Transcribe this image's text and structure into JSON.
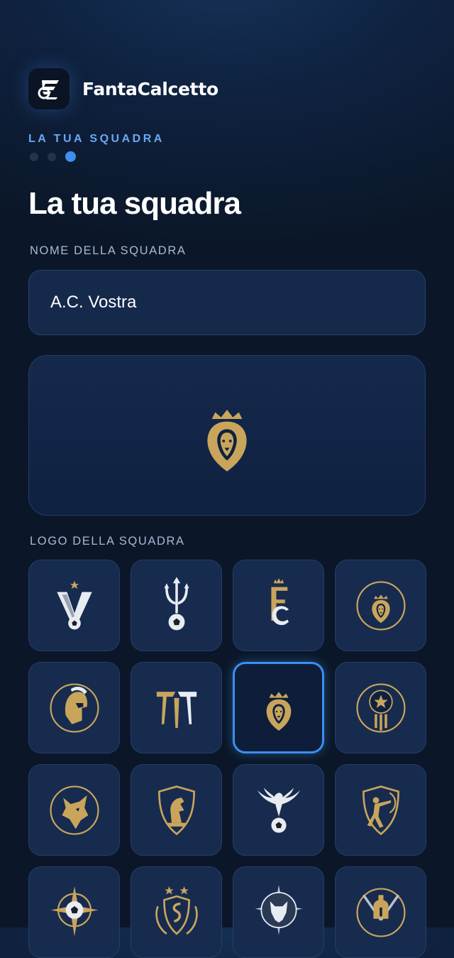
{
  "app": {
    "name": "FantaCalcetto",
    "icon": "fc-logo-icon"
  },
  "step": {
    "label": "LA TUA SQUADRA",
    "total": 3,
    "current": 3
  },
  "page": {
    "title": "La tua squadra"
  },
  "team_name": {
    "label": "NOME DELLA SQUADRA",
    "value": "A.C. Vostra"
  },
  "preview": {
    "logo": "crowned-lion-icon"
  },
  "logos": {
    "label": "LOGO DELLA SQUADRA",
    "selected_index": 6,
    "items": [
      {
        "name": "v-ball-logo"
      },
      {
        "name": "trident-ball-logo"
      },
      {
        "name": "fc-crown-logo"
      },
      {
        "name": "lion-circle-logo"
      },
      {
        "name": "spartan-helmet-logo"
      },
      {
        "name": "tt-monogram-logo"
      },
      {
        "name": "crowned-lion-logo"
      },
      {
        "name": "star-ball-pillars-logo"
      },
      {
        "name": "wolf-circle-logo"
      },
      {
        "name": "knight-shield-logo"
      },
      {
        "name": "eagle-ball-logo"
      },
      {
        "name": "archer-shield-logo"
      },
      {
        "name": "compass-ball-logo"
      },
      {
        "name": "serpent-laurel-logo"
      },
      {
        "name": "wolf-star-logo"
      },
      {
        "name": "gladiator-swords-logo"
      }
    ]
  },
  "colors": {
    "accent": "#3e8ef0",
    "gold": "#c9a55c",
    "background": "#0b1729",
    "tile": "#172b4f"
  }
}
